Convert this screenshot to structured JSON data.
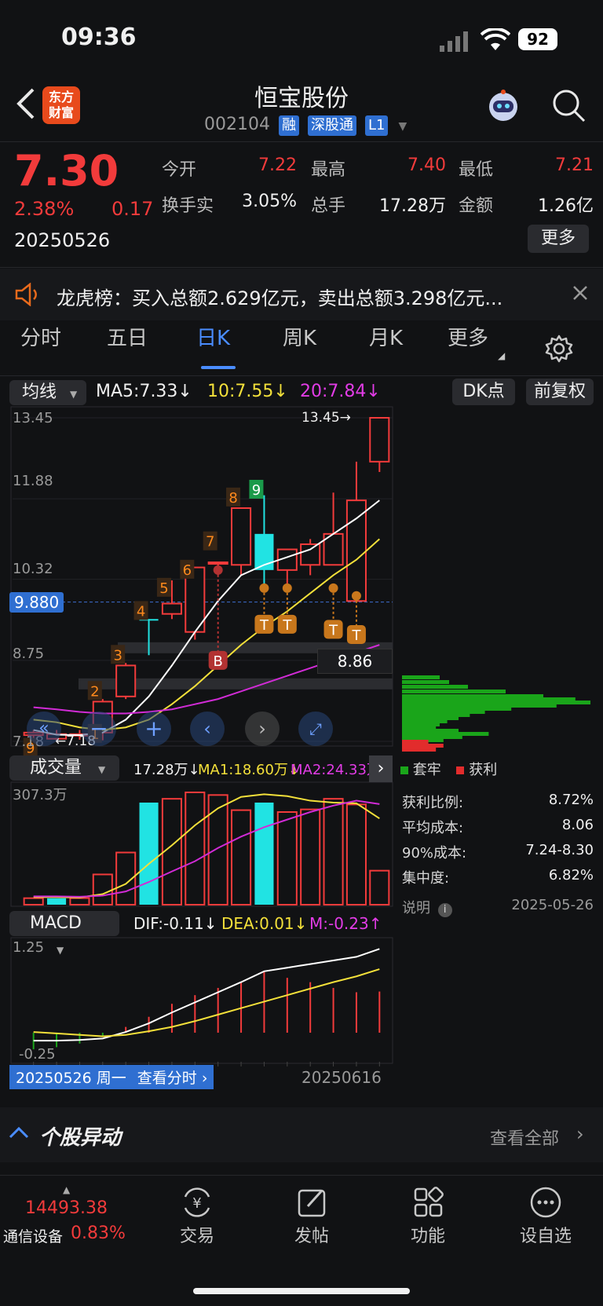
{
  "status_bar": {
    "time": "09:36",
    "battery": "92"
  },
  "header": {
    "title": "恒宝股份",
    "code": "002104",
    "badges": [
      "融",
      "深股通",
      "L1"
    ],
    "logo_line1": "东方",
    "logo_line2": "财富"
  },
  "quote": {
    "price": "7.30",
    "change_pct": "2.38%",
    "change": "0.17",
    "date": "20250526",
    "stats": [
      {
        "label": "今开",
        "value": "7.22"
      },
      {
        "label": "最高",
        "value": "7.40"
      },
      {
        "label": "最低",
        "value": "7.21"
      },
      {
        "label": "换手实",
        "value": "3.05%"
      },
      {
        "label": "总手",
        "value": "17.28万"
      },
      {
        "label": "金额",
        "value": "1.26亿"
      }
    ],
    "more_button": "更多"
  },
  "notice": {
    "text": "龙虎榜：买入总额2.629亿元，卖出总额3.298亿元..."
  },
  "tabs": [
    {
      "label": "分时"
    },
    {
      "label": "五日"
    },
    {
      "label": "日K"
    },
    {
      "label": "周K"
    },
    {
      "label": "月K"
    },
    {
      "label": "更多"
    }
  ],
  "main_chart": {
    "indicator_selector": "均线",
    "ma_labels": {
      "ma5": "MA5:7.33↓",
      "ma10": "10:7.55↓",
      "ma20": "20:7.84↓"
    },
    "dk_button": "DK点",
    "fq_button": "前复权",
    "y_labels": [
      "13.45",
      "11.88",
      "10.32",
      "8.75",
      "7.18"
    ],
    "cursor_price": "9.880",
    "pressure_price": "8.86",
    "max_label": "13.45→",
    "min_label": "←7.18"
  },
  "volume_panel": {
    "selector": "成交量",
    "summary": "17.28万↓",
    "ma1": "MA1:18.60万↓",
    "ma2": "MA2:24.33万↓",
    "max_label": "307.3万"
  },
  "macd_panel": {
    "selector": "MACD",
    "dif": "DIF:-0.11↓",
    "dea": "DEA:0.01↓",
    "m": "M:-0.23↑",
    "top_label": "1.25",
    "bottom_label": "-0.25"
  },
  "x_axis": {
    "start": "20250526 周一",
    "view_button": "查看分时",
    "end": "20250616"
  },
  "chip_panel": {
    "legend_trapped": "套牢",
    "legend_profit": "获利",
    "rows": [
      {
        "label": "获利比例:",
        "value": "8.72%"
      },
      {
        "label": "平均成本:",
        "value": "8.06"
      },
      {
        "label": "90%成本:",
        "value": "7.24-8.30"
      },
      {
        "label": "集中度:",
        "value": "6.82%"
      }
    ],
    "note_label": "说明",
    "note_date": "2025-05-26"
  },
  "anomaly": {
    "title": "个股异动",
    "view_all": "查看全部"
  },
  "bottom_nav": {
    "index_value": "14493.38",
    "index_name": "通信设备",
    "index_change": "0.83%",
    "items": [
      {
        "label": "交易"
      },
      {
        "label": "发帖"
      },
      {
        "label": "功能"
      },
      {
        "label": "设自选"
      }
    ]
  },
  "chart_data": {
    "type": "candlestick",
    "candles": [
      {
        "o": 7.35,
        "h": 7.4,
        "l": 7.18,
        "c": 7.3
      },
      {
        "o": 7.23,
        "h": 7.4,
        "l": 7.18,
        "c": 7.32
      },
      {
        "o": 7.3,
        "h": 7.4,
        "l": 7.21,
        "c": 7.32
      },
      {
        "o": 7.35,
        "h": 8.0,
        "l": 7.2,
        "c": 7.95
      },
      {
        "o": 8.05,
        "h": 8.7,
        "l": 8.0,
        "c": 8.65
      },
      {
        "o": 9.55,
        "h": 9.55,
        "l": 8.85,
        "c": 9.55
      },
      {
        "o": 9.85,
        "h": 10.3,
        "l": 9.55,
        "c": 9.65
      },
      {
        "o": 9.3,
        "h": 10.55,
        "l": 9.15,
        "c": 10.55
      },
      {
        "o": 10.65,
        "h": 10.65,
        "l": 10.4,
        "c": 10.65
      },
      {
        "o": 10.6,
        "h": 11.7,
        "l": 10.4,
        "c": 11.7
      },
      {
        "o": 11.2,
        "h": 11.95,
        "l": 10.2,
        "c": 10.5
      },
      {
        "o": 10.5,
        "h": 10.9,
        "l": 10.2,
        "c": 10.9
      },
      {
        "o": 10.6,
        "h": 11.1,
        "l": 10.4,
        "c": 11.0
      },
      {
        "o": 10.6,
        "h": 12.0,
        "l": 10.6,
        "c": 11.2
      },
      {
        "o": 9.9,
        "h": 12.6,
        "l": 9.9,
        "c": 11.85
      },
      {
        "o": 12.6,
        "h": 13.45,
        "l": 12.4,
        "c": 13.45
      }
    ],
    "ma5": [
      7.4,
      7.31,
      7.3,
      7.35,
      7.6,
      8.05,
      8.65,
      9.3,
      9.9,
      10.4,
      10.6,
      10.75,
      10.9,
      11.2,
      11.5,
      11.85
    ],
    "ma10": [
      7.6,
      7.55,
      7.45,
      7.4,
      7.45,
      7.6,
      7.9,
      8.25,
      8.65,
      9.05,
      9.4,
      9.7,
      10.05,
      10.4,
      10.7,
      11.1
    ],
    "ma20": [
      7.84,
      7.8,
      7.75,
      7.72,
      7.72,
      7.75,
      7.8,
      7.9,
      8.0,
      8.15,
      8.3,
      8.45,
      8.6,
      8.75,
      8.9,
      9.05
    ],
    "markers": [
      "9",
      "1",
      "2",
      "3",
      "4",
      "5",
      "6",
      "7",
      "8",
      "9"
    ],
    "signals": [
      "B",
      "T",
      "T",
      "T",
      "T"
    ],
    "volume": [
      17.28,
      17.0,
      17.5,
      80.0,
      138.0,
      270.0,
      280.0,
      297.0,
      290.0,
      250.0,
      270.0,
      245.0,
      252.0,
      280.0,
      265.0,
      90.0
    ],
    "volume_colors": [
      "r",
      "c",
      "r",
      "r",
      "r",
      "c",
      "r",
      "r",
      "r",
      "r",
      "c",
      "r",
      "r",
      "r",
      "r",
      "r"
    ],
    "vol_ma1": [
      20.0,
      20.0,
      19.0,
      28.0,
      55.0,
      108.0,
      157.0,
      210.0,
      255.0,
      285.0,
      292.0,
      287.0,
      275.0,
      270.0,
      268.0,
      228.0
    ],
    "vol_ma2": [
      22.0,
      22.0,
      21.0,
      24.0,
      35.0,
      60.0,
      88.0,
      115.0,
      150.0,
      180.0,
      205.0,
      225.0,
      245.0,
      262.0,
      275.0,
      266.0
    ],
    "vol_max": 307.3,
    "macd_dif": [
      -0.11,
      -0.11,
      -0.1,
      -0.08,
      0.01,
      0.13,
      0.28,
      0.42,
      0.56,
      0.7,
      0.85,
      0.9,
      0.95,
      1.0,
      1.05,
      1.16
    ],
    "macd_dea": [
      0.01,
      -0.01,
      -0.03,
      -0.05,
      -0.03,
      0.02,
      0.08,
      0.16,
      0.25,
      0.34,
      0.43,
      0.52,
      0.61,
      0.7,
      0.78,
      0.88
    ],
    "macd_hist": [
      -0.23,
      -0.2,
      -0.15,
      -0.05,
      0.08,
      0.22,
      0.4,
      0.52,
      0.62,
      0.7,
      0.84,
      0.76,
      0.7,
      0.62,
      0.56,
      0.57
    ]
  }
}
